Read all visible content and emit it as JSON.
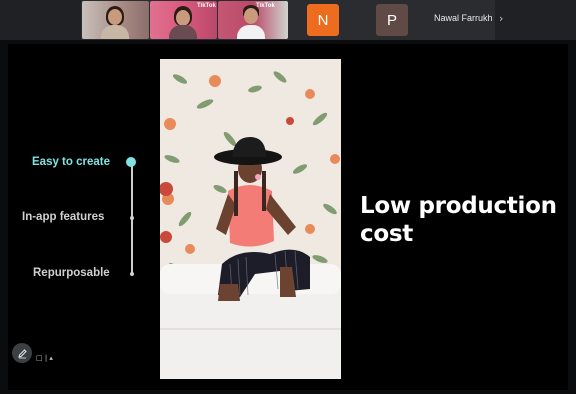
{
  "meeting": {
    "participants": [
      {
        "kind": "video",
        "watermark": "",
        "shirt": "#c9b7a6",
        "wall": "#a88a84"
      },
      {
        "kind": "video",
        "watermark": "TikTok",
        "shirt": "#6b4a53",
        "wall": "#d85a7c"
      },
      {
        "kind": "video",
        "watermark": "TikTok",
        "shirt": "#f2f2f2",
        "wall": "#c45774"
      },
      {
        "kind": "avatar",
        "initial": "N",
        "color": "#ed6c1e"
      },
      {
        "kind": "avatar",
        "initial": "P",
        "color": "#5f4a46"
      }
    ],
    "active_name": "Nawal Farrukh",
    "more_icon": "chevron-right-icon"
  },
  "slide": {
    "timeline": [
      {
        "label": "Easy to create",
        "active": true,
        "color": "#7fe3e3"
      },
      {
        "label": "In-app features",
        "active": false,
        "color": "#d0d0d0"
      },
      {
        "label": "Repurposable",
        "active": false,
        "color": "#d0d0d0"
      }
    ],
    "headline_line1": "Low production",
    "headline_line2": "cost",
    "photo_description_icon": "cowboy-hat-woman-photo"
  },
  "tools": {
    "pen_icon": "pencil-icon",
    "glyph": "□ | ▴"
  }
}
